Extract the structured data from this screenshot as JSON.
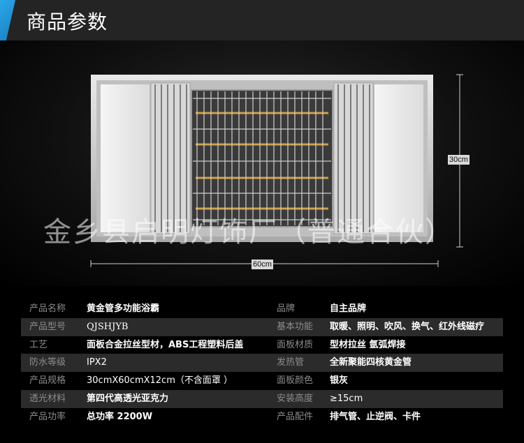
{
  "header": {
    "title": "商品参数",
    "accent_color": "#2aa7ea"
  },
  "image": {
    "height_label": "30cm",
    "width_label": "60cm",
    "watermark": "金乡县启明灯饰厂（普通合伙）"
  },
  "specs": [
    {
      "label1": "产品名称",
      "value1": "黄金管多功能浴霸",
      "label2": "品牌",
      "value2": "自主品牌"
    },
    {
      "label1": "产品型号",
      "value1": "QJSHJYB",
      "label2": "基本功能",
      "value2": "取暖、照明、吹风、换气、红外线磁疗"
    },
    {
      "label1": "工艺",
      "value1": "面板合金拉丝型材，ABS工程塑料后盖",
      "label2": "面板材质",
      "value2": "型材拉丝 氩弧焊接"
    },
    {
      "label1": "防水等级",
      "value1": "IPX2",
      "label2": "发热管",
      "value2": "全新聚能四核黄金管"
    },
    {
      "label1": "产品规格",
      "value1": "30cmX60cmX12cm（不含面罩 ）",
      "label2": "面板颜色",
      "value2": "银灰"
    },
    {
      "label1": "透光材料",
      "value1": "第四代高透光亚克力",
      "label2": "安装高度",
      "value2": "≥15cm"
    },
    {
      "label1": "产品功率",
      "value1": "总功率 2200W",
      "label2": "产品配件",
      "value2": "排气管、止逆阀、卡件"
    }
  ]
}
